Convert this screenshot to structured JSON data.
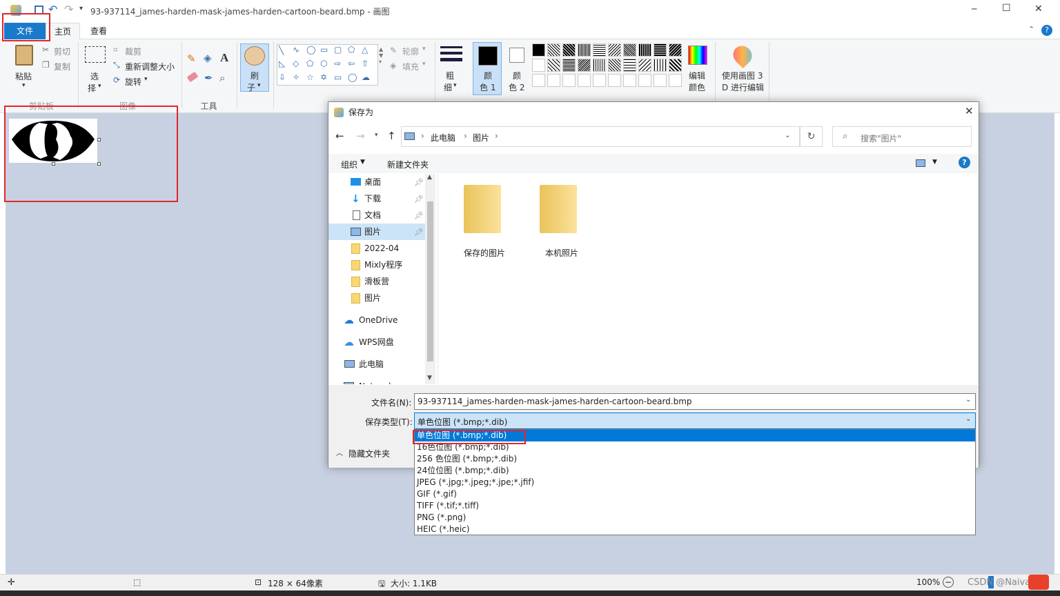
{
  "titlebar": {
    "title": "93-937114_james-harden-mask-james-harden-cartoon-beard.bmp - 画图",
    "min": "─",
    "max": "☐",
    "close": "✕"
  },
  "tabs": {
    "file": "文件",
    "home": "主页",
    "view": "查看"
  },
  "ribbon": {
    "paste": "粘贴",
    "cut": "剪切",
    "copy": "复制",
    "clipboard_group": "剪贴板",
    "select": "选\n择",
    "select_a": "选",
    "select_b": "择",
    "crop": "裁剪",
    "resize": "重新调整大小",
    "rotate": "旋转",
    "image_group": "图像",
    "tools_group": "工具",
    "brush_a": "刷",
    "brush_b": "子",
    "outline": "轮廓",
    "fill": "填充",
    "size_a": "粗",
    "size_b": "细",
    "color1_a": "颜",
    "color1_b": "色 1",
    "color2_a": "颜",
    "color2_b": "色 2",
    "edit_colors_a": "编辑",
    "edit_colors_b": "颜色",
    "paint3d_a": "使用画图 3",
    "paint3d_b": "D 进行编辑"
  },
  "dialog": {
    "title": "保存为",
    "breadcrumb": [
      "此电脑",
      "图片"
    ],
    "search_placeholder": "搜索\"图片\"",
    "organize": "组织",
    "new_folder": "新建文件夹",
    "nav": [
      {
        "label": "桌面"
      },
      {
        "label": "下载"
      },
      {
        "label": "文档"
      },
      {
        "label": "图片"
      },
      {
        "label": "2022-04"
      },
      {
        "label": "Mixly程序"
      },
      {
        "label": "滑板营"
      },
      {
        "label": "图片"
      },
      {
        "label": "OneDrive"
      },
      {
        "label": "WPS网盘"
      },
      {
        "label": "此电脑"
      },
      {
        "label": "Network"
      }
    ],
    "folders": [
      {
        "label": "保存的图片"
      },
      {
        "label": "本机照片"
      }
    ],
    "filename_label": "文件名(N):",
    "filename_value": "93-937114_james-harden-mask-james-harden-cartoon-beard.bmp",
    "type_label": "保存类型(T):",
    "type_value": "单色位图 (*.bmp;*.dib)",
    "hide_folders": "隐藏文件夹",
    "type_options": [
      "单色位图 (*.bmp;*.dib)",
      "16色位图 (*.bmp;*.dib)",
      "256 色位图 (*.bmp;*.dib)",
      "24位位图 (*.bmp;*.dib)",
      "JPEG (*.jpg;*.jpeg;*.jpe;*.jfif)",
      "GIF (*.gif)",
      "TIFF (*.tif;*.tiff)",
      "PNG (*.png)",
      "HEIC (*.heic)"
    ]
  },
  "status": {
    "dimensions": "128 × 64像素",
    "size": "大小: 1.1KB",
    "zoom": "100%",
    "watermark": "CSDN @Naiva"
  },
  "colors": {
    "accent": "#1979ca",
    "highlight": "#0078d7",
    "annotation": "#e0262b",
    "canvas_bg": "#c8d1e1"
  }
}
